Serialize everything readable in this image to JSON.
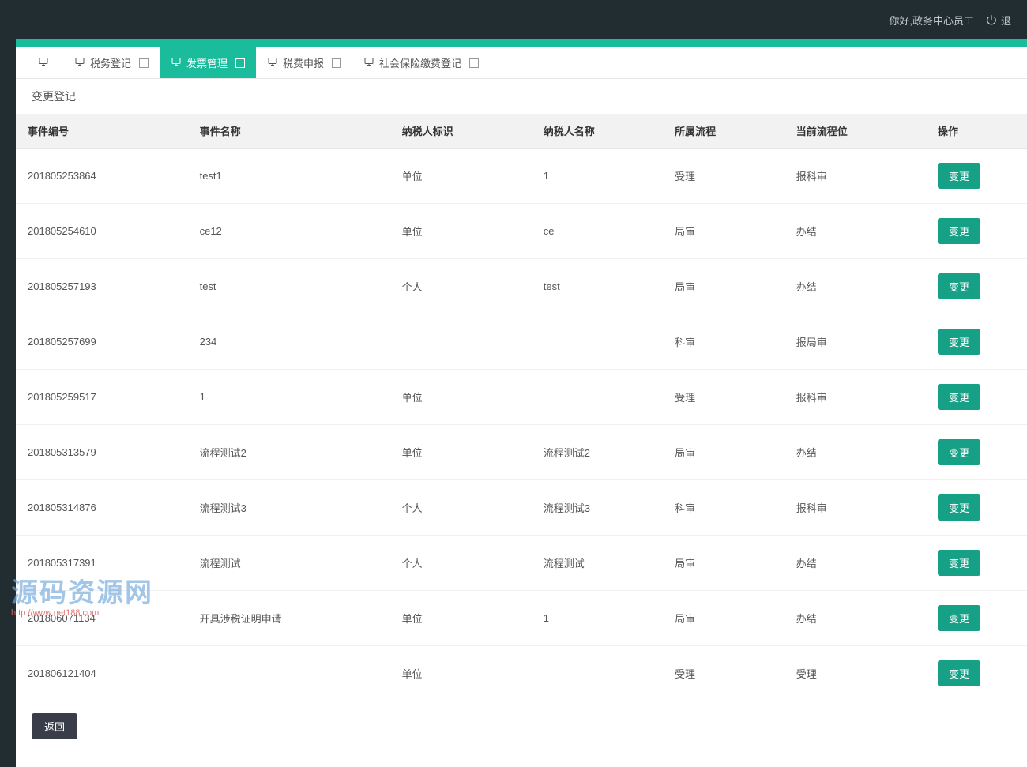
{
  "header": {
    "greeting": "你好,政务中心员工",
    "logout_label": "退"
  },
  "tabs": [
    {
      "label": "",
      "active": false,
      "is_home": true
    },
    {
      "label": "税务登记",
      "active": false,
      "is_home": false
    },
    {
      "label": "发票管理",
      "active": true,
      "is_home": false
    },
    {
      "label": "税费申报",
      "active": false,
      "is_home": false
    },
    {
      "label": "社会保险缴费登记",
      "active": false,
      "is_home": false
    }
  ],
  "page": {
    "title": "变更登记",
    "back_label": "返回"
  },
  "table": {
    "headers": {
      "event_id": "事件编号",
      "event_name": "事件名称",
      "taxpayer_tag": "纳税人标识",
      "taxpayer_name": "纳税人名称",
      "process": "所属流程",
      "stage": "当前流程位",
      "operation": "操作"
    },
    "action_label": "变更",
    "rows": [
      {
        "event_id": "201805253864",
        "event_name": "test1",
        "taxpayer_tag": "单位",
        "taxpayer_name": "1",
        "process": "受理",
        "stage": "报科审"
      },
      {
        "event_id": "201805254610",
        "event_name": "ce12",
        "taxpayer_tag": "单位",
        "taxpayer_name": "ce",
        "process": "局审",
        "stage": "办结"
      },
      {
        "event_id": "201805257193",
        "event_name": "test",
        "taxpayer_tag": "个人",
        "taxpayer_name": "test",
        "process": "局审",
        "stage": "办结"
      },
      {
        "event_id": "201805257699",
        "event_name": "234",
        "taxpayer_tag": "",
        "taxpayer_name": "",
        "process": "科审",
        "stage": "报局审"
      },
      {
        "event_id": "201805259517",
        "event_name": "1",
        "taxpayer_tag": "单位",
        "taxpayer_name": "",
        "process": "受理",
        "stage": "报科审"
      },
      {
        "event_id": "201805313579",
        "event_name": "流程测试2",
        "taxpayer_tag": "单位",
        "taxpayer_name": "流程测试2",
        "process": "局审",
        "stage": "办结"
      },
      {
        "event_id": "201805314876",
        "event_name": "流程测试3",
        "taxpayer_tag": "个人",
        "taxpayer_name": "流程测试3",
        "process": "科审",
        "stage": "报科审"
      },
      {
        "event_id": "201805317391",
        "event_name": "流程测试",
        "taxpayer_tag": "个人",
        "taxpayer_name": "流程测试",
        "process": "局审",
        "stage": "办结"
      },
      {
        "event_id": "201806071134",
        "event_name": "开具涉税证明申请",
        "taxpayer_tag": "单位",
        "taxpayer_name": "1",
        "process": "局审",
        "stage": "办结"
      },
      {
        "event_id": "201806121404",
        "event_name": "",
        "taxpayer_tag": "单位",
        "taxpayer_name": "",
        "process": "受理",
        "stage": "受理"
      }
    ]
  },
  "watermark": {
    "big": "源码资源网",
    "small": "http://www.net188.com"
  }
}
